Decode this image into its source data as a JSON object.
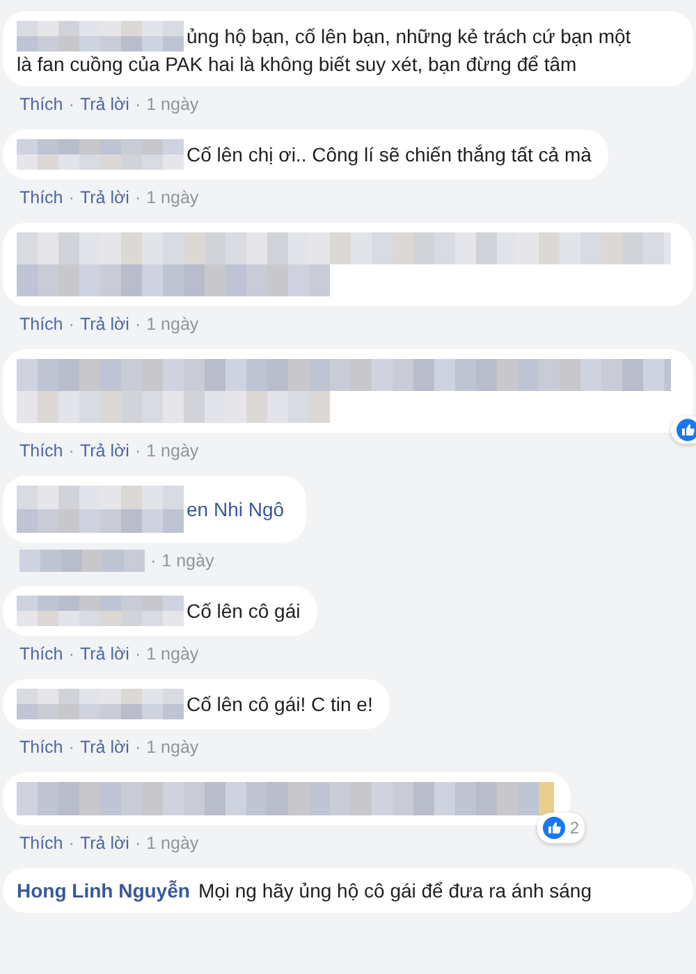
{
  "comments": [
    {
      "kind": "text",
      "name_hidden": true,
      "lines": [
        "ủng hộ bạn, cố lên bạn, những kẻ trách cứ bạn một",
        "là fan cuồng của PAK hai là không biết suy xét, bạn đừng để tâm"
      ],
      "meta": {
        "like": "Thích",
        "sep1": "·",
        "reply": "Trả lời",
        "sep2": "·",
        "time": "1 ngày"
      }
    },
    {
      "kind": "text",
      "name_hidden": true,
      "lines": [
        "Cố lên chị ơi.. Công lí sẽ chiến thắng tất cả mà"
      ],
      "meta": {
        "like": "Thích",
        "sep1": "·",
        "reply": "Trả lời",
        "sep2": "·",
        "time": "1 ngày"
      }
    },
    {
      "kind": "blurred-two-line",
      "meta": {
        "like": "Thích",
        "sep1": "·",
        "reply": "Trả lời",
        "sep2": "·",
        "time": "1 ngày"
      }
    },
    {
      "kind": "blurred-two-line",
      "reaction_badge": true,
      "meta": {
        "like": "Thích",
        "sep1": "·",
        "reply": "Trả lời",
        "sep2": "·",
        "time": "1 ngày"
      }
    },
    {
      "kind": "text",
      "name_hidden": true,
      "author": "en Nhi Ngô",
      "meta": {
        "sep2": "·",
        "time": "1 ngày"
      }
    },
    {
      "kind": "text",
      "name_hidden": true,
      "lines": [
        "Cố lên cô gái"
      ],
      "meta": {
        "like": "Thích",
        "sep1": "·",
        "reply": "Trả lời",
        "sep2": "·",
        "time": "1 ngày"
      }
    },
    {
      "kind": "text",
      "name_hidden": true,
      "lines": [
        "Cố lên cô gái! C tin e!"
      ],
      "meta": {
        "like": "Thích",
        "sep1": "·",
        "reply": "Trả lời",
        "sep2": "·",
        "time": "1 ngày"
      }
    },
    {
      "kind": "blurred-one-line",
      "reaction_badge": true,
      "reaction_count": "2",
      "meta": {
        "like": "Thích",
        "sep1": "·",
        "reply": "Trả lời",
        "sep2": "·",
        "time": "1 ngày"
      }
    },
    {
      "kind": "text",
      "name_hidden": false,
      "author": "Hong Linh Nguyễn",
      "lines": [
        "Mọi ng hãy ủng hộ cô gái để đưa ra ánh sáng"
      ]
    }
  ]
}
